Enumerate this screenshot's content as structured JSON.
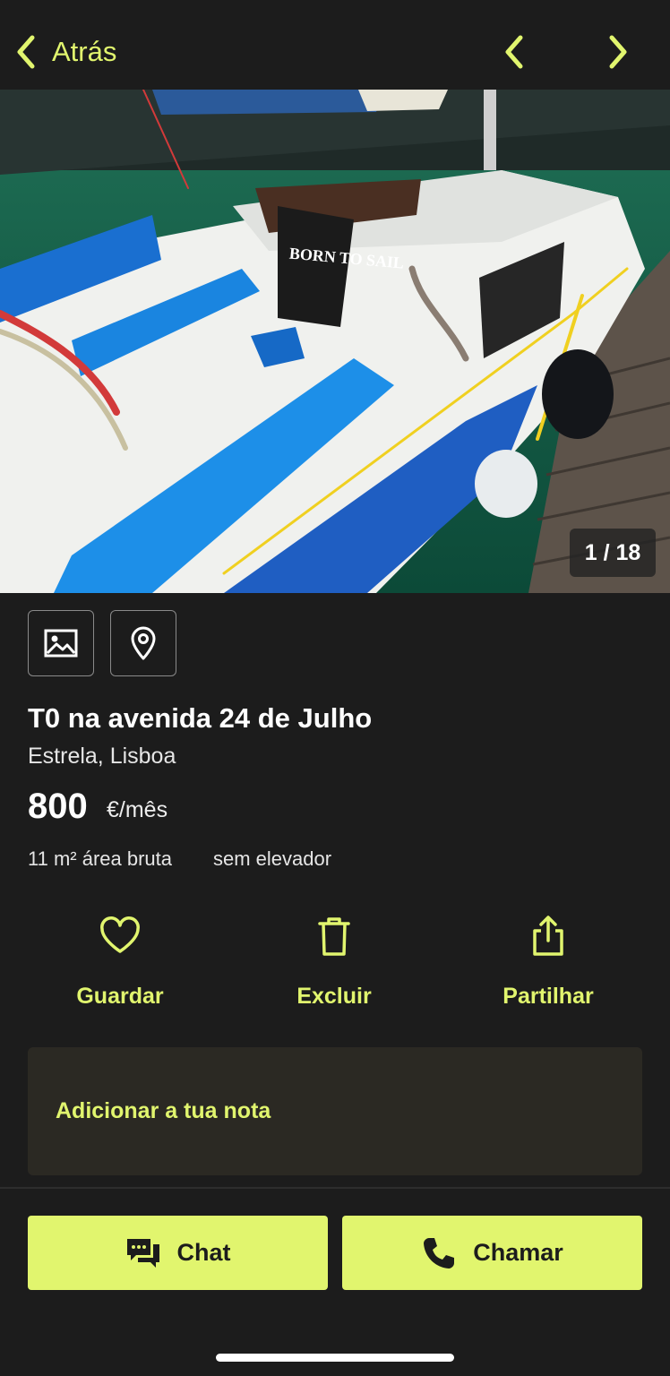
{
  "colors": {
    "accent": "#e1f56e",
    "background": "#1c1c1c",
    "note_bg": "#2b2923"
  },
  "header": {
    "back_label": "Atrás",
    "back_icon": "chevron-left-icon",
    "prev_icon": "chevron-left-icon",
    "next_icon": "chevron-right-icon"
  },
  "gallery": {
    "counter": "1 / 18",
    "photo_text": "BORN TO SAIL"
  },
  "media_tabs": [
    {
      "icon": "image-icon"
    },
    {
      "icon": "map-pin-icon"
    }
  ],
  "listing": {
    "title": "T0 na avenida 24 de Julho",
    "location": "Estrela, Lisboa",
    "price": "800",
    "price_unit": "€/mês",
    "features": [
      "11 m² área bruta",
      "sem elevador"
    ]
  },
  "actions": [
    {
      "label": "Guardar",
      "icon": "heart-icon"
    },
    {
      "label": "Excluir",
      "icon": "trash-icon"
    },
    {
      "label": "Partilhar",
      "icon": "share-icon"
    }
  ],
  "note": {
    "label": "Adicionar a tua nota"
  },
  "bottom_bar": {
    "chat_label": "Chat",
    "chat_icon": "chat-icon",
    "call_label": "Chamar",
    "call_icon": "phone-icon"
  }
}
